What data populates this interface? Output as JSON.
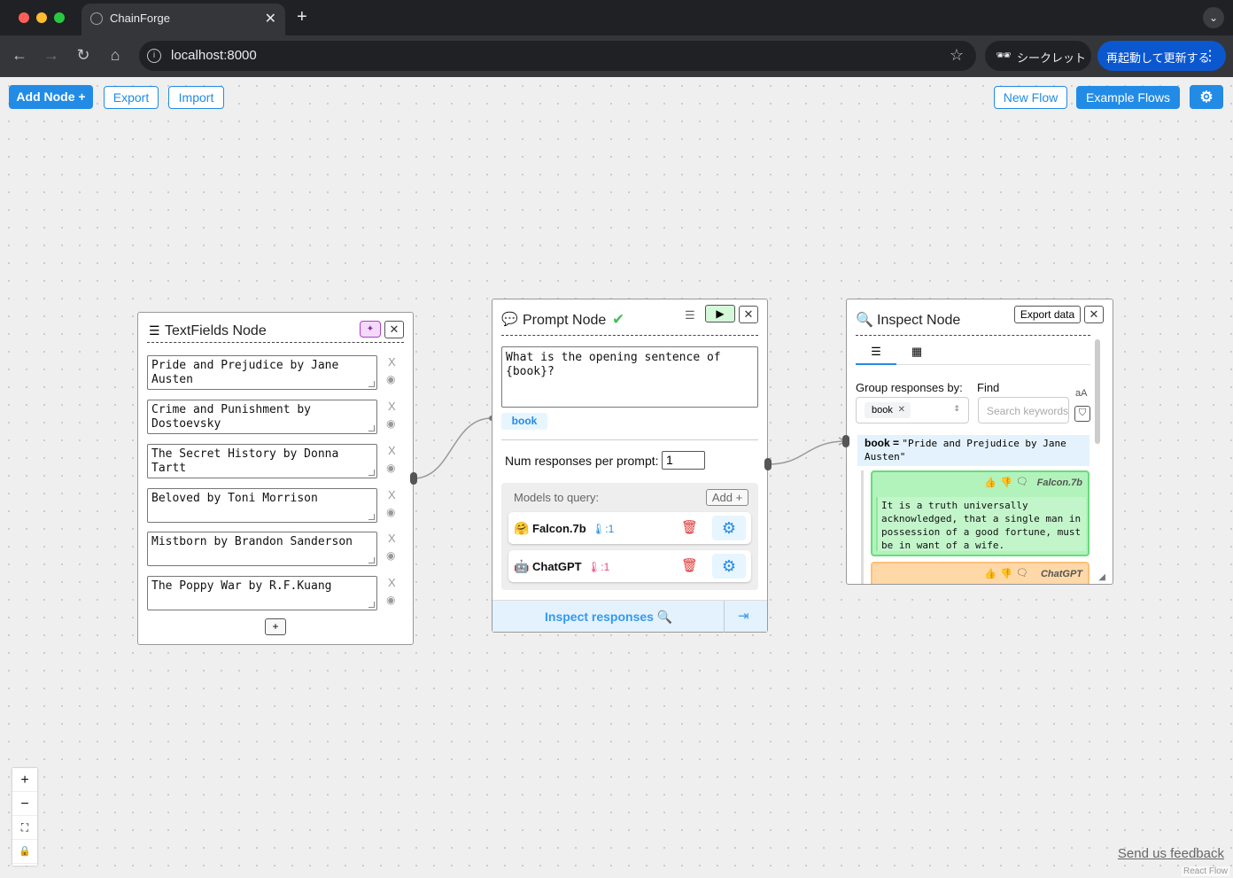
{
  "browser": {
    "tab_title": "ChainForge",
    "tab_close": "✕",
    "new_tab": "+",
    "url": "localhost:8000",
    "incognito_label": "シークレット",
    "relaunch_label": "再起動して更新する"
  },
  "app_toolbar": {
    "add_node_label": "Add Node +",
    "export_label": "Export",
    "import_label": "Import",
    "new_flow_label": "New Flow",
    "example_flows_label": "Example Flows"
  },
  "textfields_node": {
    "title": "TextFields Node",
    "fields": [
      "Pride and Prejudice by Jane Austen",
      "Crime and Punishment by Dostoevsky",
      "The Secret History by Donna Tartt",
      "Beloved by Toni Morrison",
      "Mistborn by Brandon Sanderson",
      "The Poppy War by R.F.Kuang"
    ],
    "remove_label": "X",
    "add_label": "+"
  },
  "prompt_node": {
    "title": "Prompt Node",
    "checkmark": "✔",
    "prompt_text": "What is the opening sentence of {book}?",
    "var_tag": "book",
    "num_responses_label": "Num responses per prompt:",
    "num_responses_value": "1",
    "models_label": "Models to query:",
    "add_model_label": "Add +",
    "models": [
      {
        "emoji": "🤗",
        "name": "Falcon.7b",
        "temp": "🌡:1",
        "temp_color": "#228be6"
      },
      {
        "emoji": "🤖",
        "name": "ChatGPT",
        "temp": "🌡:1",
        "temp_color": "#e64980"
      }
    ],
    "inspect_label": "Inspect responses 🔍"
  },
  "inspect_node": {
    "title": "Inspect Node",
    "export_label": "Export data",
    "group_by_label": "Group responses by:",
    "group_by_chip": "book",
    "find_label": "Find",
    "search_placeholder": "Search keywords",
    "var_label": "book =",
    "var_value": "\"Pride and Prejudice by Jane Austen\"",
    "responses": [
      {
        "model": "Falcon.7b",
        "text": "It is a truth universally acknowledged, that a single man in possession of a good fortune, must be in want of a wife.",
        "color": "#b2f2bb"
      },
      {
        "model": "ChatGPT",
        "color": "#ffd8a8"
      }
    ]
  },
  "footer": {
    "feedback_label": "Send us feedback",
    "attribution": "React Flow"
  }
}
